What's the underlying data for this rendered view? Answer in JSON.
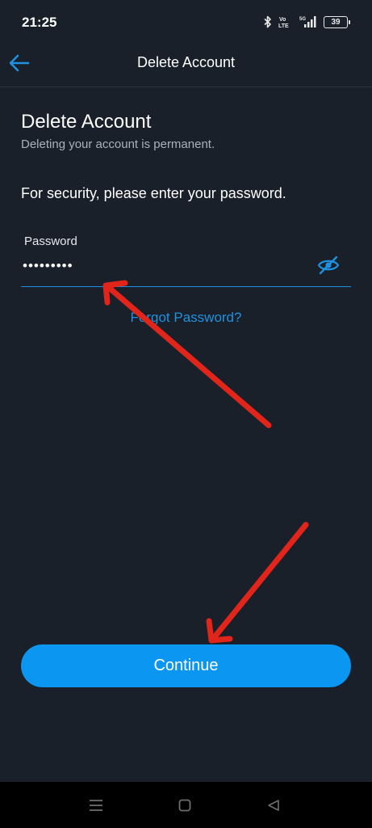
{
  "status_bar": {
    "time": "21:25",
    "battery_level": "39",
    "network": "5G",
    "volte": "Vo LTE",
    "icons": [
      "bluetooth-icon",
      "volte-icon",
      "signal-icon",
      "battery-icon"
    ]
  },
  "app_bar": {
    "title": "Delete Account",
    "back_icon": "back-arrow-icon"
  },
  "content": {
    "heading": "Delete Account",
    "subtitle": "Deleting your account is permanent.",
    "prompt": "For security, please enter your password."
  },
  "password_field": {
    "label": "Password",
    "value": "•••••••••",
    "toggle_icon": "eye-off-icon"
  },
  "forgot_password": "Forgot Password?",
  "continue_button": "Continue",
  "annotations": {
    "arrow_color": "#e1251b",
    "description_icons": [
      "annotation-arrow-to-password",
      "annotation-arrow-to-continue"
    ]
  },
  "nav_bar": {
    "icons": [
      "recents-icon",
      "home-icon",
      "back-icon"
    ]
  },
  "colors": {
    "background": "#192029",
    "accent": "#0a96f1",
    "link": "#1f91df"
  }
}
